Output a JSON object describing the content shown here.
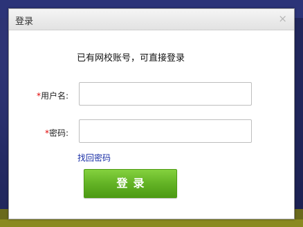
{
  "dialog": {
    "title": "登录",
    "close_label": "×",
    "notice": "已有网校账号，可直接登录",
    "username": {
      "required_mark": "*",
      "label": "用户名:",
      "value": "",
      "placeholder": ""
    },
    "password": {
      "required_mark": "*",
      "label": "密码:",
      "value": "",
      "placeholder": ""
    },
    "forgot_link": "找回密码",
    "login_button": "登录"
  },
  "colors": {
    "login_button": "#63b325",
    "link": "#1a2fa6",
    "required": "#e00000"
  }
}
